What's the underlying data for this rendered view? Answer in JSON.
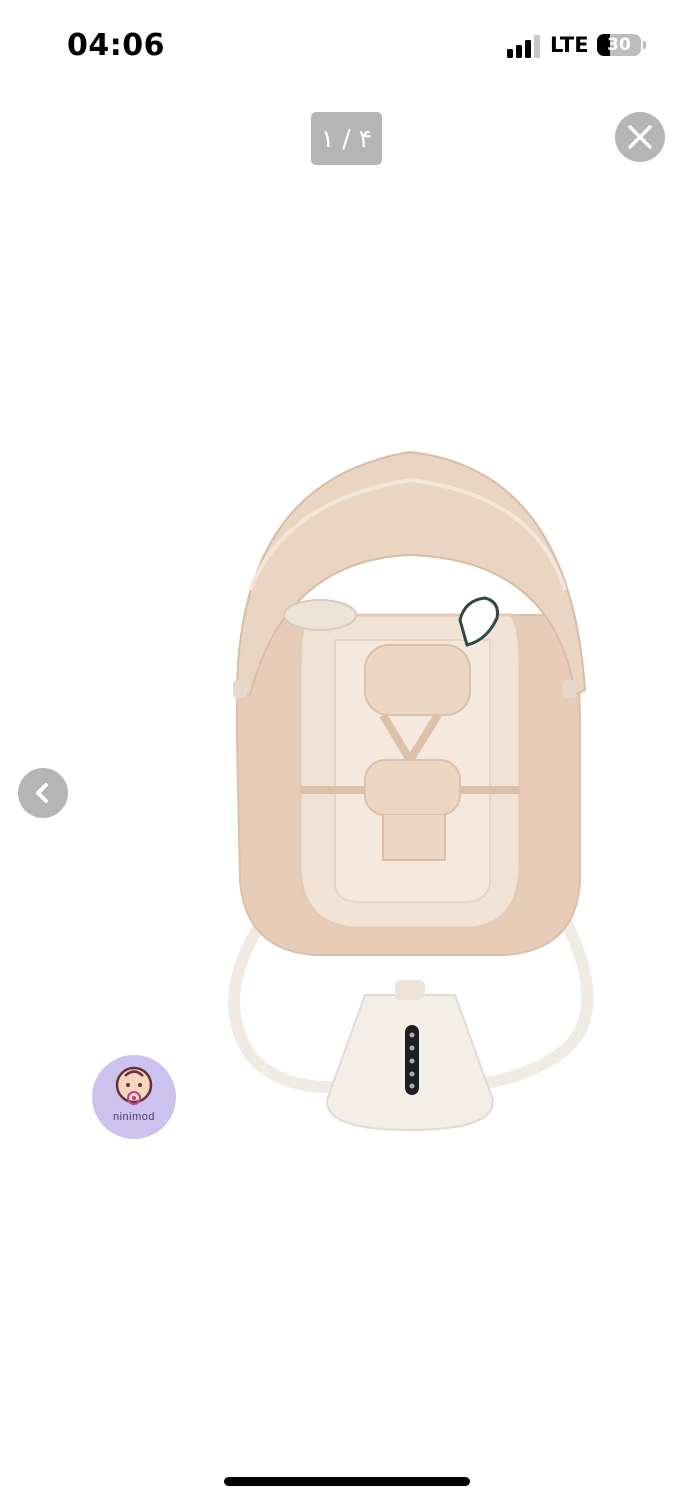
{
  "status_bar": {
    "time": "04:06",
    "network": "LTE",
    "battery_level": "30",
    "battery_percent": 30,
    "signal_bars_active": 3,
    "signal_bars_total": 4
  },
  "viewer": {
    "page_counter": "۱ / ۴",
    "close_icon": "close-x-icon",
    "prev_icon": "chevron-left-icon",
    "overlay_color": "#b5b5b5"
  },
  "product": {
    "icon": "baby-swing-chair",
    "colors": {
      "seat": "#e7cdb8",
      "seat_inner": "#f1e2d6",
      "canopy": "#ead4c2",
      "base": "#f3eee6"
    }
  },
  "brand_logo": {
    "text": "ninimod",
    "background": "#cbc3ee"
  }
}
